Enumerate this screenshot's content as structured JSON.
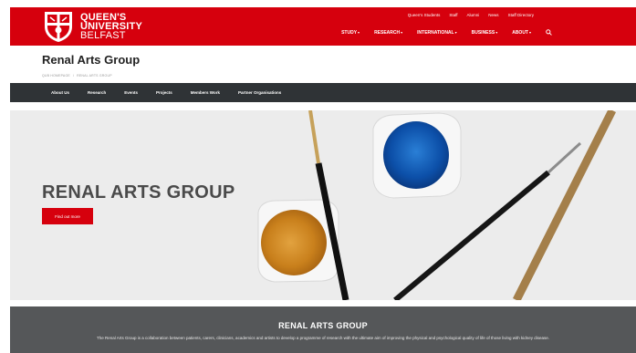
{
  "header": {
    "logo_lines": [
      "QUEEN'S",
      "UNIVERSITY",
      "BELFAST"
    ],
    "utility_links": [
      "Queen's Students",
      "Staff",
      "Alumni",
      "News",
      "Staff Directory"
    ],
    "main_nav": [
      "STUDY",
      "RESEARCH",
      "INTERNATIONAL",
      "BUSINESS",
      "ABOUT"
    ],
    "search_icon": "search-icon",
    "brand_color": "#d6000d"
  },
  "page": {
    "title": "Renal Arts Group",
    "breadcrumb": [
      "QUB HOMEPAGE",
      "RENAL ARTS GROUP"
    ]
  },
  "subnav": {
    "items": [
      "About Us",
      "Research",
      "Events",
      "Projects",
      "Members Work",
      "Partner Organisations"
    ],
    "background": "#2f3336"
  },
  "hero": {
    "title": "RENAL ARTS GROUP",
    "button_label": "Find out more"
  },
  "intro": {
    "title": "RENAL ARTS GROUP",
    "text": "The Renal Arts Group is a collaboration between patients, carers, clinicians, academics and artists to develop a programme of research with the ultimate aim of improving the physical and psychological quality of life of those living with kidney disease."
  }
}
